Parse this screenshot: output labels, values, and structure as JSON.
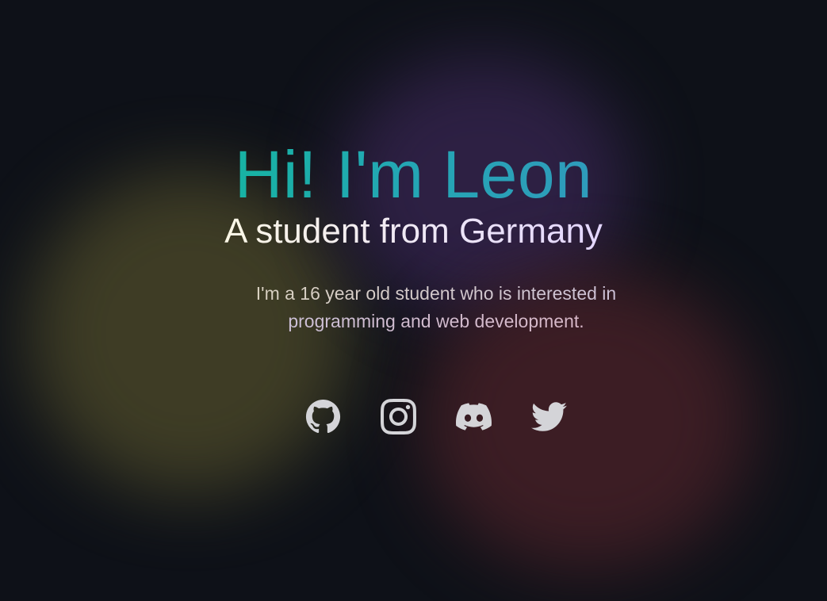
{
  "hero": {
    "headline": "Hi! I'm Leon",
    "subtitle": "A student from Germany",
    "bio": "I'm a 16 year old student who is interested in programming and web development."
  },
  "socials": [
    {
      "icon": "github-icon"
    },
    {
      "icon": "instagram-icon"
    },
    {
      "icon": "discord-icon"
    },
    {
      "icon": "twitter-icon"
    }
  ],
  "colors": {
    "background": "#0e1118",
    "headline_gradient_start": "#17b3a3",
    "headline_gradient_end": "#2f9bbb",
    "icon": "#d4d4d8",
    "blob_yellow": "#413f26",
    "blob_purple": "#2f2146",
    "blob_red": "#3f1e25"
  }
}
